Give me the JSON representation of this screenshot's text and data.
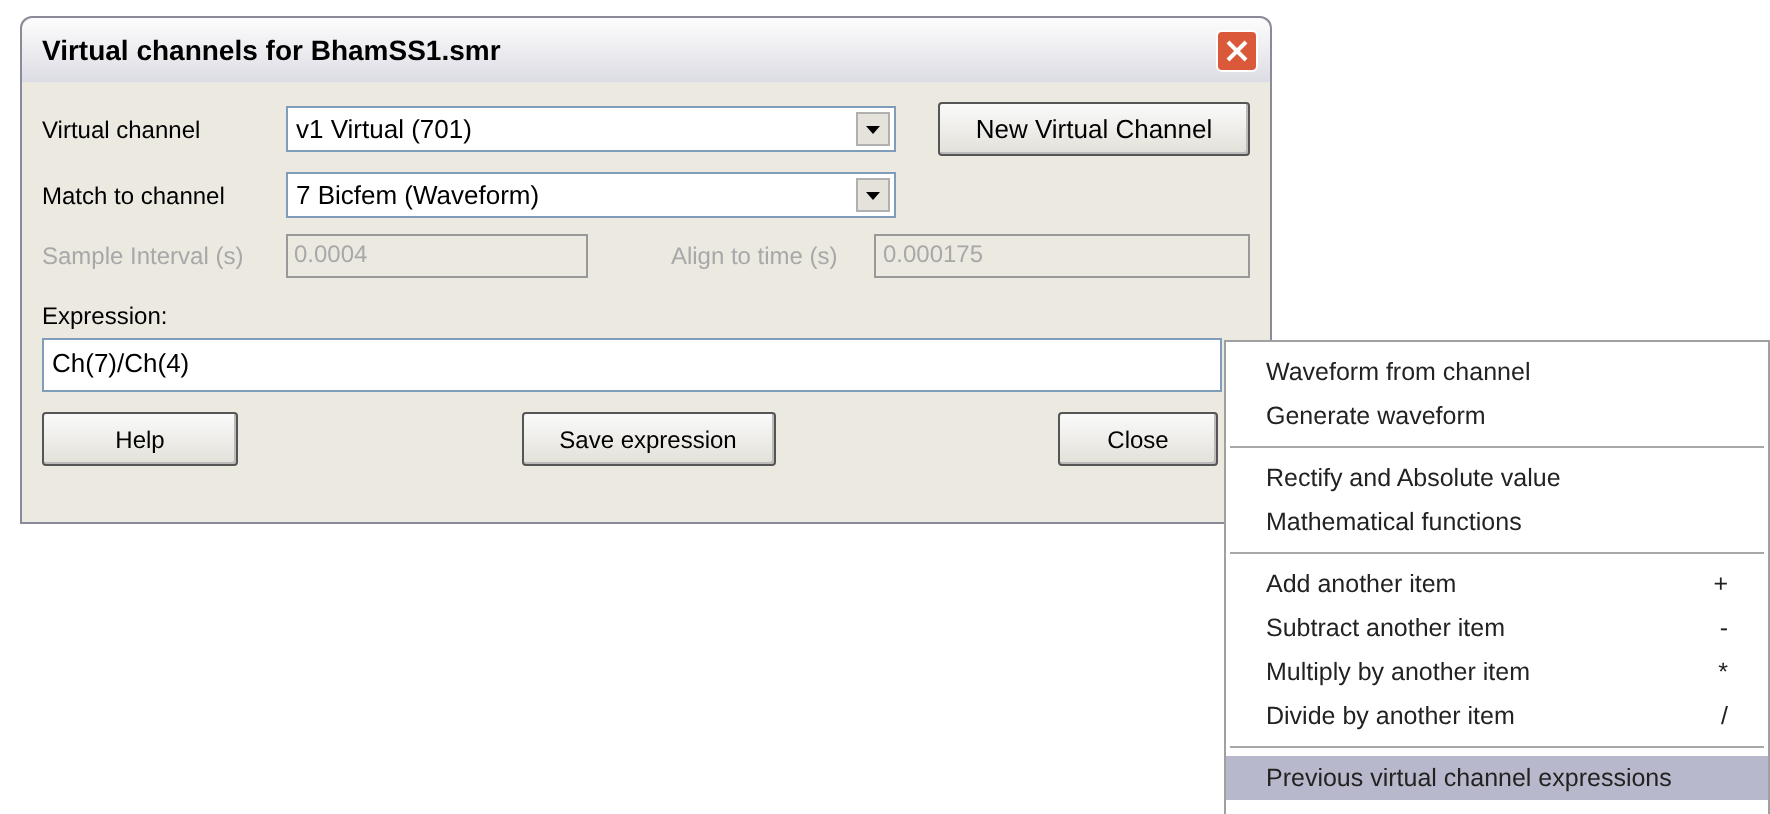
{
  "window": {
    "title": "Virtual channels for BhamSS1.smr"
  },
  "virtual_channel": {
    "label": "Virtual channel",
    "value": "v1 Virtual (701)"
  },
  "new_button": "New Virtual Channel",
  "match_channel": {
    "label": "Match to channel",
    "value": "7 Bicfem (Waveform)"
  },
  "sample_interval": {
    "label": "Sample Interval (s)",
    "value": "0.0004",
    "disabled": true
  },
  "align_to_time": {
    "label": "Align to time (s)",
    "value": "0.000175",
    "disabled": true
  },
  "expression": {
    "label": "Expression:",
    "value": "Ch(7)/Ch(4)"
  },
  "buttons": [
    "Help",
    "Save expression",
    "Close"
  ],
  "menu": {
    "groups": [
      [
        {
          "label": "Waveform from channel",
          "selected": false
        },
        {
          "label": "Generate waveform",
          "selected": false
        }
      ],
      [
        {
          "label": "Rectify and Absolute value",
          "selected": false
        },
        {
          "label": "Mathematical functions",
          "selected": false
        }
      ],
      [
        {
          "label": "Add another item",
          "shortcut": "+",
          "selected": false
        },
        {
          "label": "Subtract another item",
          "shortcut": "-",
          "selected": false
        },
        {
          "label": "Multiply by another item",
          "shortcut": "*",
          "selected": false
        },
        {
          "label": "Divide by another item",
          "shortcut": "/",
          "selected": false
        }
      ],
      [
        {
          "label": "Previous virtual channel expressions",
          "selected": true
        }
      ]
    ]
  }
}
